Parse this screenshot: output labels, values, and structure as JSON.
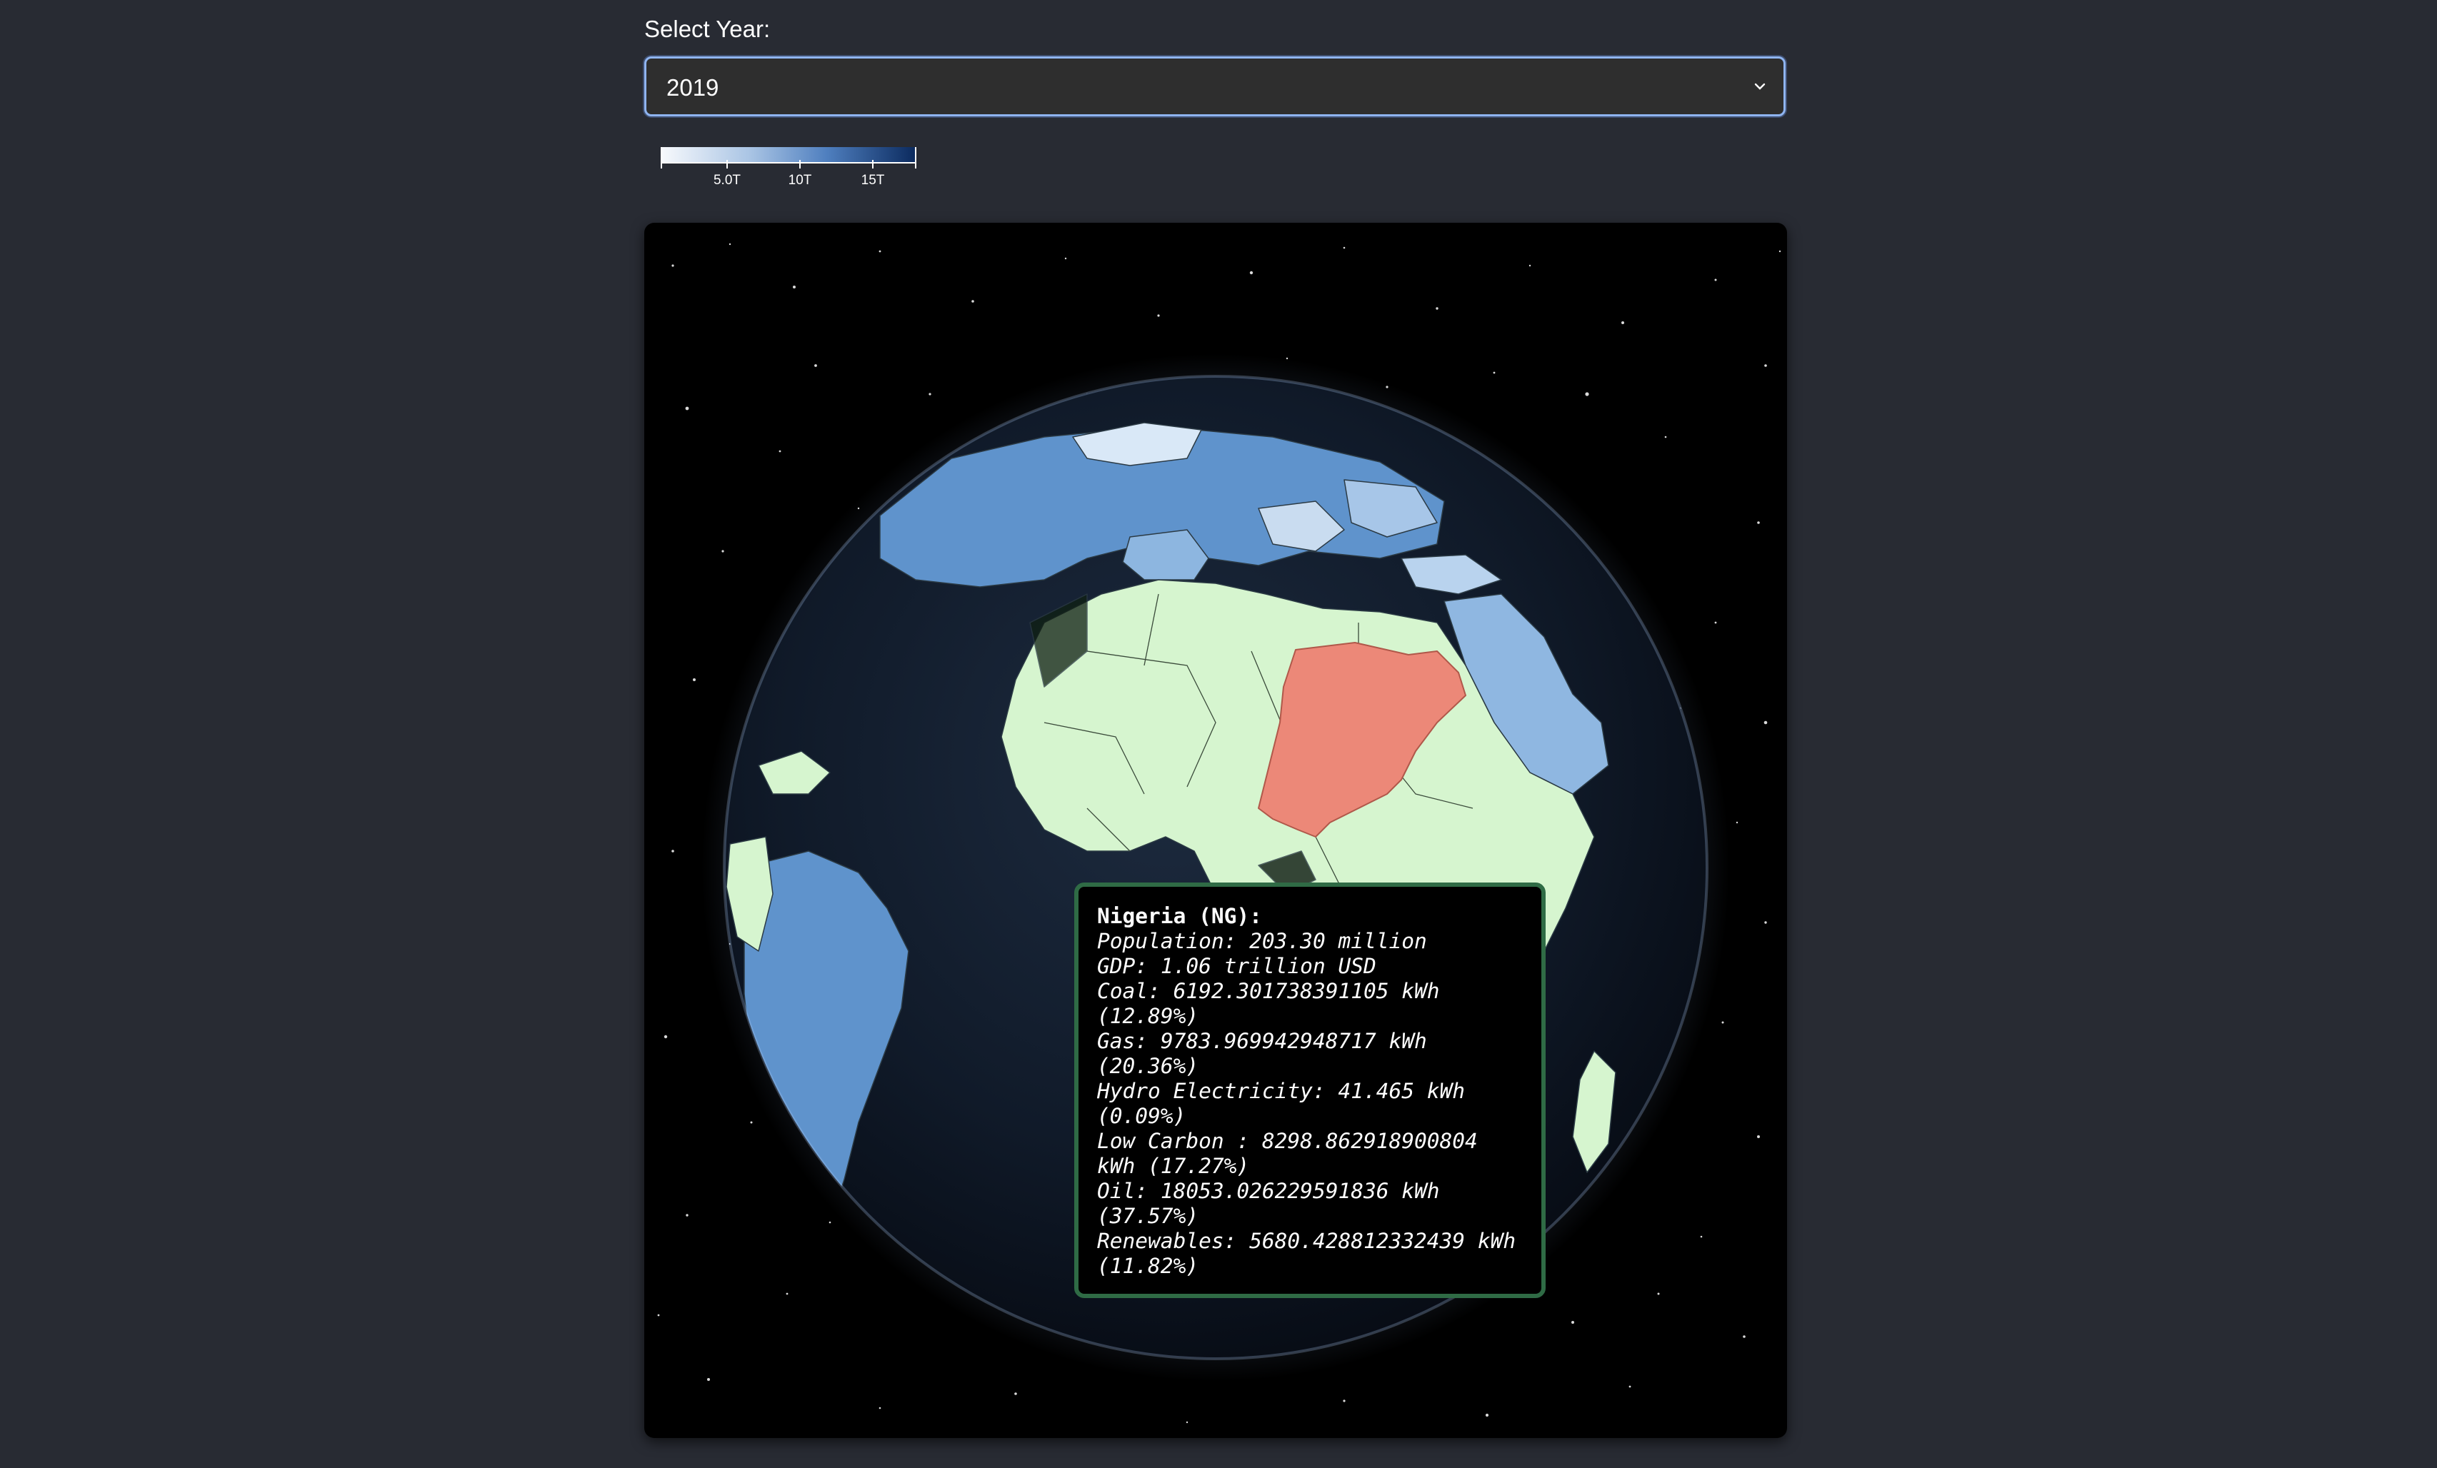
{
  "selector": {
    "label": "Select Year:",
    "selected_value": "2019"
  },
  "legend": {
    "ticks": [
      "5.0T",
      "10T",
      "15T"
    ],
    "color_low": "#f2f5fb",
    "color_mid": "#5f92cc",
    "color_high": "#0b2a5e"
  },
  "colors": {
    "page_bg": "#282b33",
    "highlight_country": "#ec8878",
    "low_value_land": "#d6f5cf",
    "tooltip_border": "#2f6b45",
    "select_border": "#8fb4f0"
  },
  "tooltip": {
    "title": "Nigeria (NG):",
    "rows": [
      {
        "label": "Population: ",
        "value": "203.30 million"
      },
      {
        "label": "GDP: ",
        "value": "1.06 trillion USD"
      },
      {
        "label": "Coal: ",
        "value": "6192.301738391105 kWh (12.89%)"
      },
      {
        "label": "Gas: ",
        "value": "9783.969942948717 kWh (20.36%)"
      },
      {
        "label": "Hydro Electricity: ",
        "value": "41.465 kWh (0.09%)"
      },
      {
        "label": "Low Carbon : ",
        "value": "8298.862918900804 kWh (17.27%)"
      },
      {
        "label": "Oil: ",
        "value": "18053.026229591836 kWh (37.57%)"
      },
      {
        "label": "Renewables: ",
        "value": "5680.428812332439 kWh (11.82%)"
      }
    ]
  }
}
